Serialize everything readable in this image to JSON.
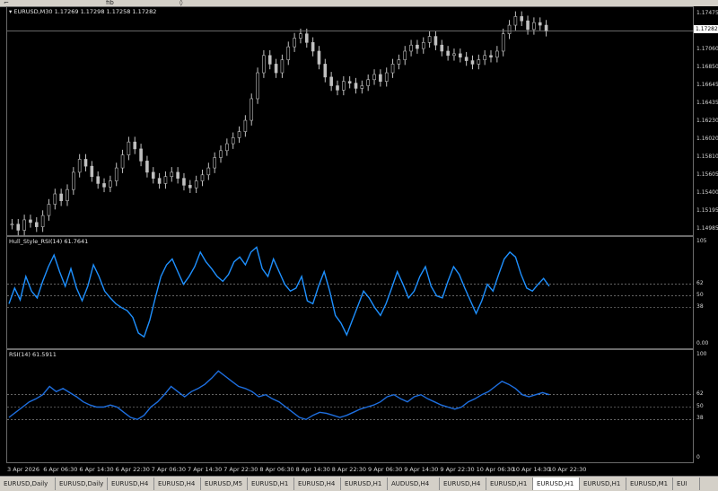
{
  "main": {
    "symbol_line": "EURUSD,M30  1.17269 1.17298 1.17258 1.17282",
    "current_price": "1.17282",
    "price_ticks": [
      "1.17475",
      "1.17060",
      "1.16850",
      "1.16645",
      "1.16435",
      "1.16230",
      "1.16020",
      "1.15810",
      "1.15605",
      "1.15400",
      "1.15195",
      "1.14985"
    ]
  },
  "hull": {
    "label": "Hull_Style_RSI(14) 61.7641",
    "scale": [
      "105",
      "62",
      "50",
      "38",
      "0.00"
    ]
  },
  "rsi": {
    "label": "RSI(14) 61.5911",
    "scale": [
      "100",
      "62",
      "50",
      "38",
      "0"
    ]
  },
  "time_axis": [
    "3 Apr 2026",
    "6 Apr 06:30",
    "6 Apr 14:30",
    "6 Apr 22:30",
    "7 Apr 06:30",
    "7 Apr 14:30",
    "7 Apr 22:30",
    "8 Apr 06:30",
    "8 Apr 14:30",
    "8 Apr 22:30",
    "9 Apr 06:30",
    "9 Apr 14:30",
    "9 Apr 22:30",
    "10 Apr 06:30",
    "10 Apr 14:30",
    "10 Apr 22:30"
  ],
  "tabs": [
    "EURUSD,Daily",
    "EURUSD,Daily",
    "EURUSD,H4",
    "EURUSD,H4",
    "EURUSD,M5",
    "EURUSD,H1",
    "EURUSD,H4",
    "EURUSD,H1",
    "AUDUSD,H4",
    "EURUSD,H4",
    "EURUSD,H1",
    "EURUSD,H1",
    "EURUSD,H1",
    "EURUSD,M1",
    "EUI"
  ],
  "active_tab_index": 11,
  "colors": {
    "candle": "#c0c0c0",
    "hull_line": "#1e90ff",
    "rsi_line": "#1e6fe0",
    "level_line": "#a0a0a0"
  },
  "chart_data": [
    {
      "type": "candlestick",
      "title": "EURUSD,M30",
      "ylim": [
        1.14985,
        1.17475
      ],
      "close": [
        1.1505,
        1.1498,
        1.151,
        1.1507,
        1.1502,
        1.1515,
        1.1528,
        1.154,
        1.1532,
        1.1545,
        1.1565,
        1.158,
        1.1572,
        1.156,
        1.1552,
        1.1548,
        1.1555,
        1.157,
        1.1585,
        1.16,
        1.1592,
        1.1578,
        1.1565,
        1.1558,
        1.1552,
        1.156,
        1.1565,
        1.1558,
        1.155,
        1.1547,
        1.1555,
        1.1562,
        1.157,
        1.1582,
        1.159,
        1.1598,
        1.1605,
        1.1612,
        1.1625,
        1.165,
        1.168,
        1.17,
        1.169,
        1.168,
        1.1695,
        1.171,
        1.172,
        1.1725,
        1.1715,
        1.1705,
        1.169,
        1.1675,
        1.1665,
        1.166,
        1.167,
        1.1668,
        1.1662,
        1.1665,
        1.1672,
        1.1678,
        1.167,
        1.168,
        1.169,
        1.1695,
        1.1705,
        1.1712,
        1.1708,
        1.1715,
        1.1722,
        1.1712,
        1.1705,
        1.17,
        1.1702,
        1.1698,
        1.1694,
        1.169,
        1.1695,
        1.17,
        1.1698,
        1.1705,
        1.1725,
        1.1735,
        1.1745,
        1.174,
        1.173,
        1.1738,
        1.1735,
        1.1728
      ]
    },
    {
      "type": "line",
      "title": "Hull_Style_RSI(14)",
      "ylim": [
        0,
        105
      ],
      "levels": [
        62,
        50,
        38
      ],
      "values": [
        42,
        58,
        46,
        70,
        55,
        48,
        65,
        80,
        92,
        75,
        60,
        78,
        58,
        45,
        60,
        82,
        70,
        55,
        48,
        42,
        38,
        35,
        28,
        12,
        8,
        25,
        48,
        70,
        82,
        88,
        75,
        62,
        70,
        80,
        95,
        85,
        78,
        70,
        65,
        72,
        85,
        90,
        82,
        95,
        100,
        78,
        70,
        88,
        75,
        62,
        55,
        58,
        70,
        45,
        42,
        60,
        75,
        55,
        30,
        22,
        10,
        25,
        40,
        55,
        48,
        38,
        30,
        42,
        58,
        75,
        62,
        48,
        55,
        70,
        80,
        60,
        50,
        48,
        65,
        80,
        72,
        58,
        45,
        32,
        45,
        62,
        55,
        72,
        88,
        95,
        90,
        72,
        58,
        55,
        62,
        68,
        60
      ]
    },
    {
      "type": "line",
      "title": "RSI(14)",
      "ylim": [
        0,
        100
      ],
      "levels": [
        62,
        50,
        38
      ],
      "values": [
        40,
        45,
        50,
        55,
        58,
        62,
        70,
        65,
        68,
        64,
        60,
        55,
        52,
        50,
        50,
        52,
        50,
        45,
        40,
        38,
        42,
        50,
        55,
        62,
        70,
        65,
        60,
        65,
        68,
        72,
        78,
        85,
        80,
        75,
        70,
        68,
        65,
        60,
        62,
        58,
        55,
        50,
        45,
        40,
        38,
        42,
        45,
        44,
        42,
        40,
        42,
        45,
        48,
        50,
        52,
        55,
        60,
        62,
        58,
        55,
        60,
        62,
        58,
        55,
        52,
        50,
        48,
        50,
        55,
        58,
        62,
        65,
        70,
        75,
        72,
        68,
        62,
        60,
        62,
        64,
        62
      ]
    }
  ]
}
